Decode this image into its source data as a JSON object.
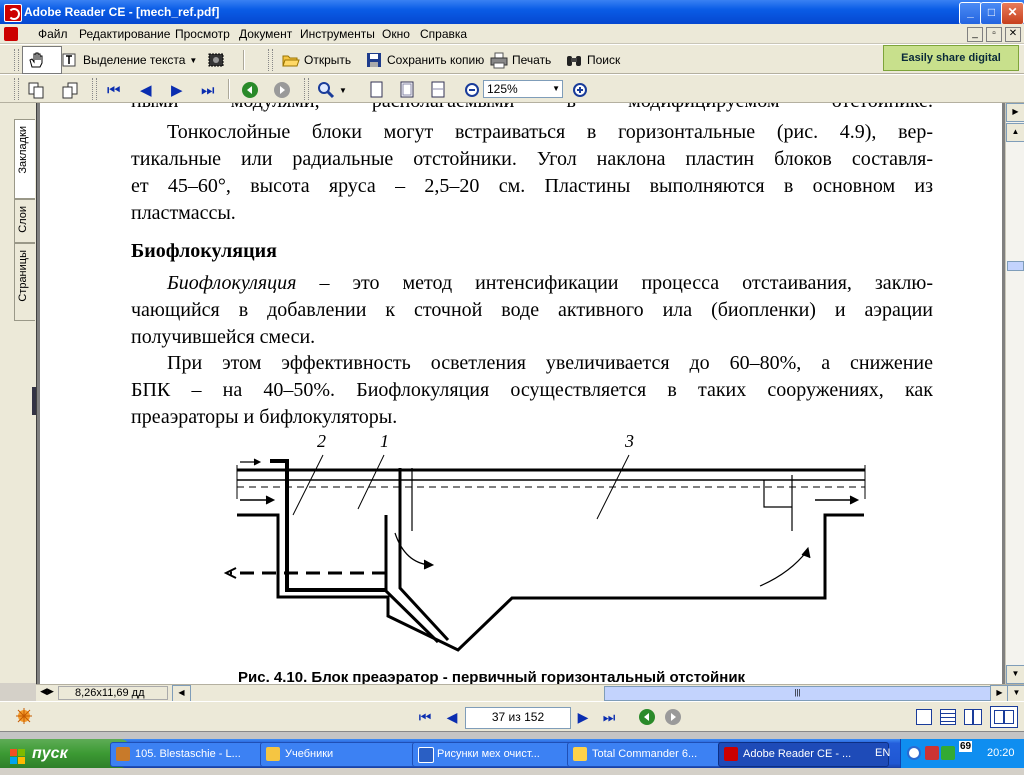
{
  "window": {
    "title": "Adobe Reader CE - [mech_ref.pdf]",
    "buttons": {
      "minimize": "_",
      "maximize": "□",
      "close": "✕"
    }
  },
  "menu": {
    "items": [
      "Файл",
      "Редактирование",
      "Просмотр",
      "Документ",
      "Инструменты",
      "Окно",
      "Справка"
    ],
    "doc_buttons": [
      "_",
      "▫",
      "✕"
    ]
  },
  "toolbar1": {
    "select_text": "Выделение текста",
    "open": "Открыть",
    "save_copy": "Сохранить копию",
    "print": "Печать",
    "search": "Поиск"
  },
  "promo": "Easily share digital photos",
  "toolbar2": {
    "zoom": "125%"
  },
  "side_tabs": [
    "Закладки",
    "Слои",
    "Страницы"
  ],
  "document": {
    "lines": [
      "ными модулями, располагаемыми в модифицируемом отстойнике.",
      "Тонкослойные блоки могут встраиваться в горизонтальные (рис. 4.9), вер-",
      "тикальные или радиальные отстойники. Угол наклона пластин блоков составля-",
      "ет 45–60°, высота яруса – 2,5–20 см. Пластины выполняются в основном из",
      "пластмассы.",
      "Биофлокуляция",
      "Биофлокуляция",
      " – это метод интенсификации процесса отстаивания, заклю-",
      "чающийся в добавлении к сточной воде активного ила (биопленки) и аэрации",
      "получившейся смеси.",
      "При этом эффективность осветления увеличивается до 60–80%, а снижение",
      "БПК – на 40–50%. Биофлокуляция осуществляется в таких сооружениях, как",
      "преаэраторы и бифлокуляторы."
    ],
    "figure_labels": [
      "2",
      "1",
      "3"
    ],
    "caption": "Рис. 4.10. Блок преаэратор - первичный горизонтальный отстойник"
  },
  "status": {
    "page_size": "8,26x11,69 дд"
  },
  "navigation": {
    "page_field": "37 из 152"
  },
  "taskbar": {
    "start": "пуск",
    "tasks": [
      "105. Blestaschie - L...",
      "Учебники",
      "Рисунки мех очист...",
      "Total Commander 6...",
      "Adobe Reader CE - ..."
    ],
    "lang": "EN",
    "tray_number": "69",
    "clock": "20:20"
  }
}
